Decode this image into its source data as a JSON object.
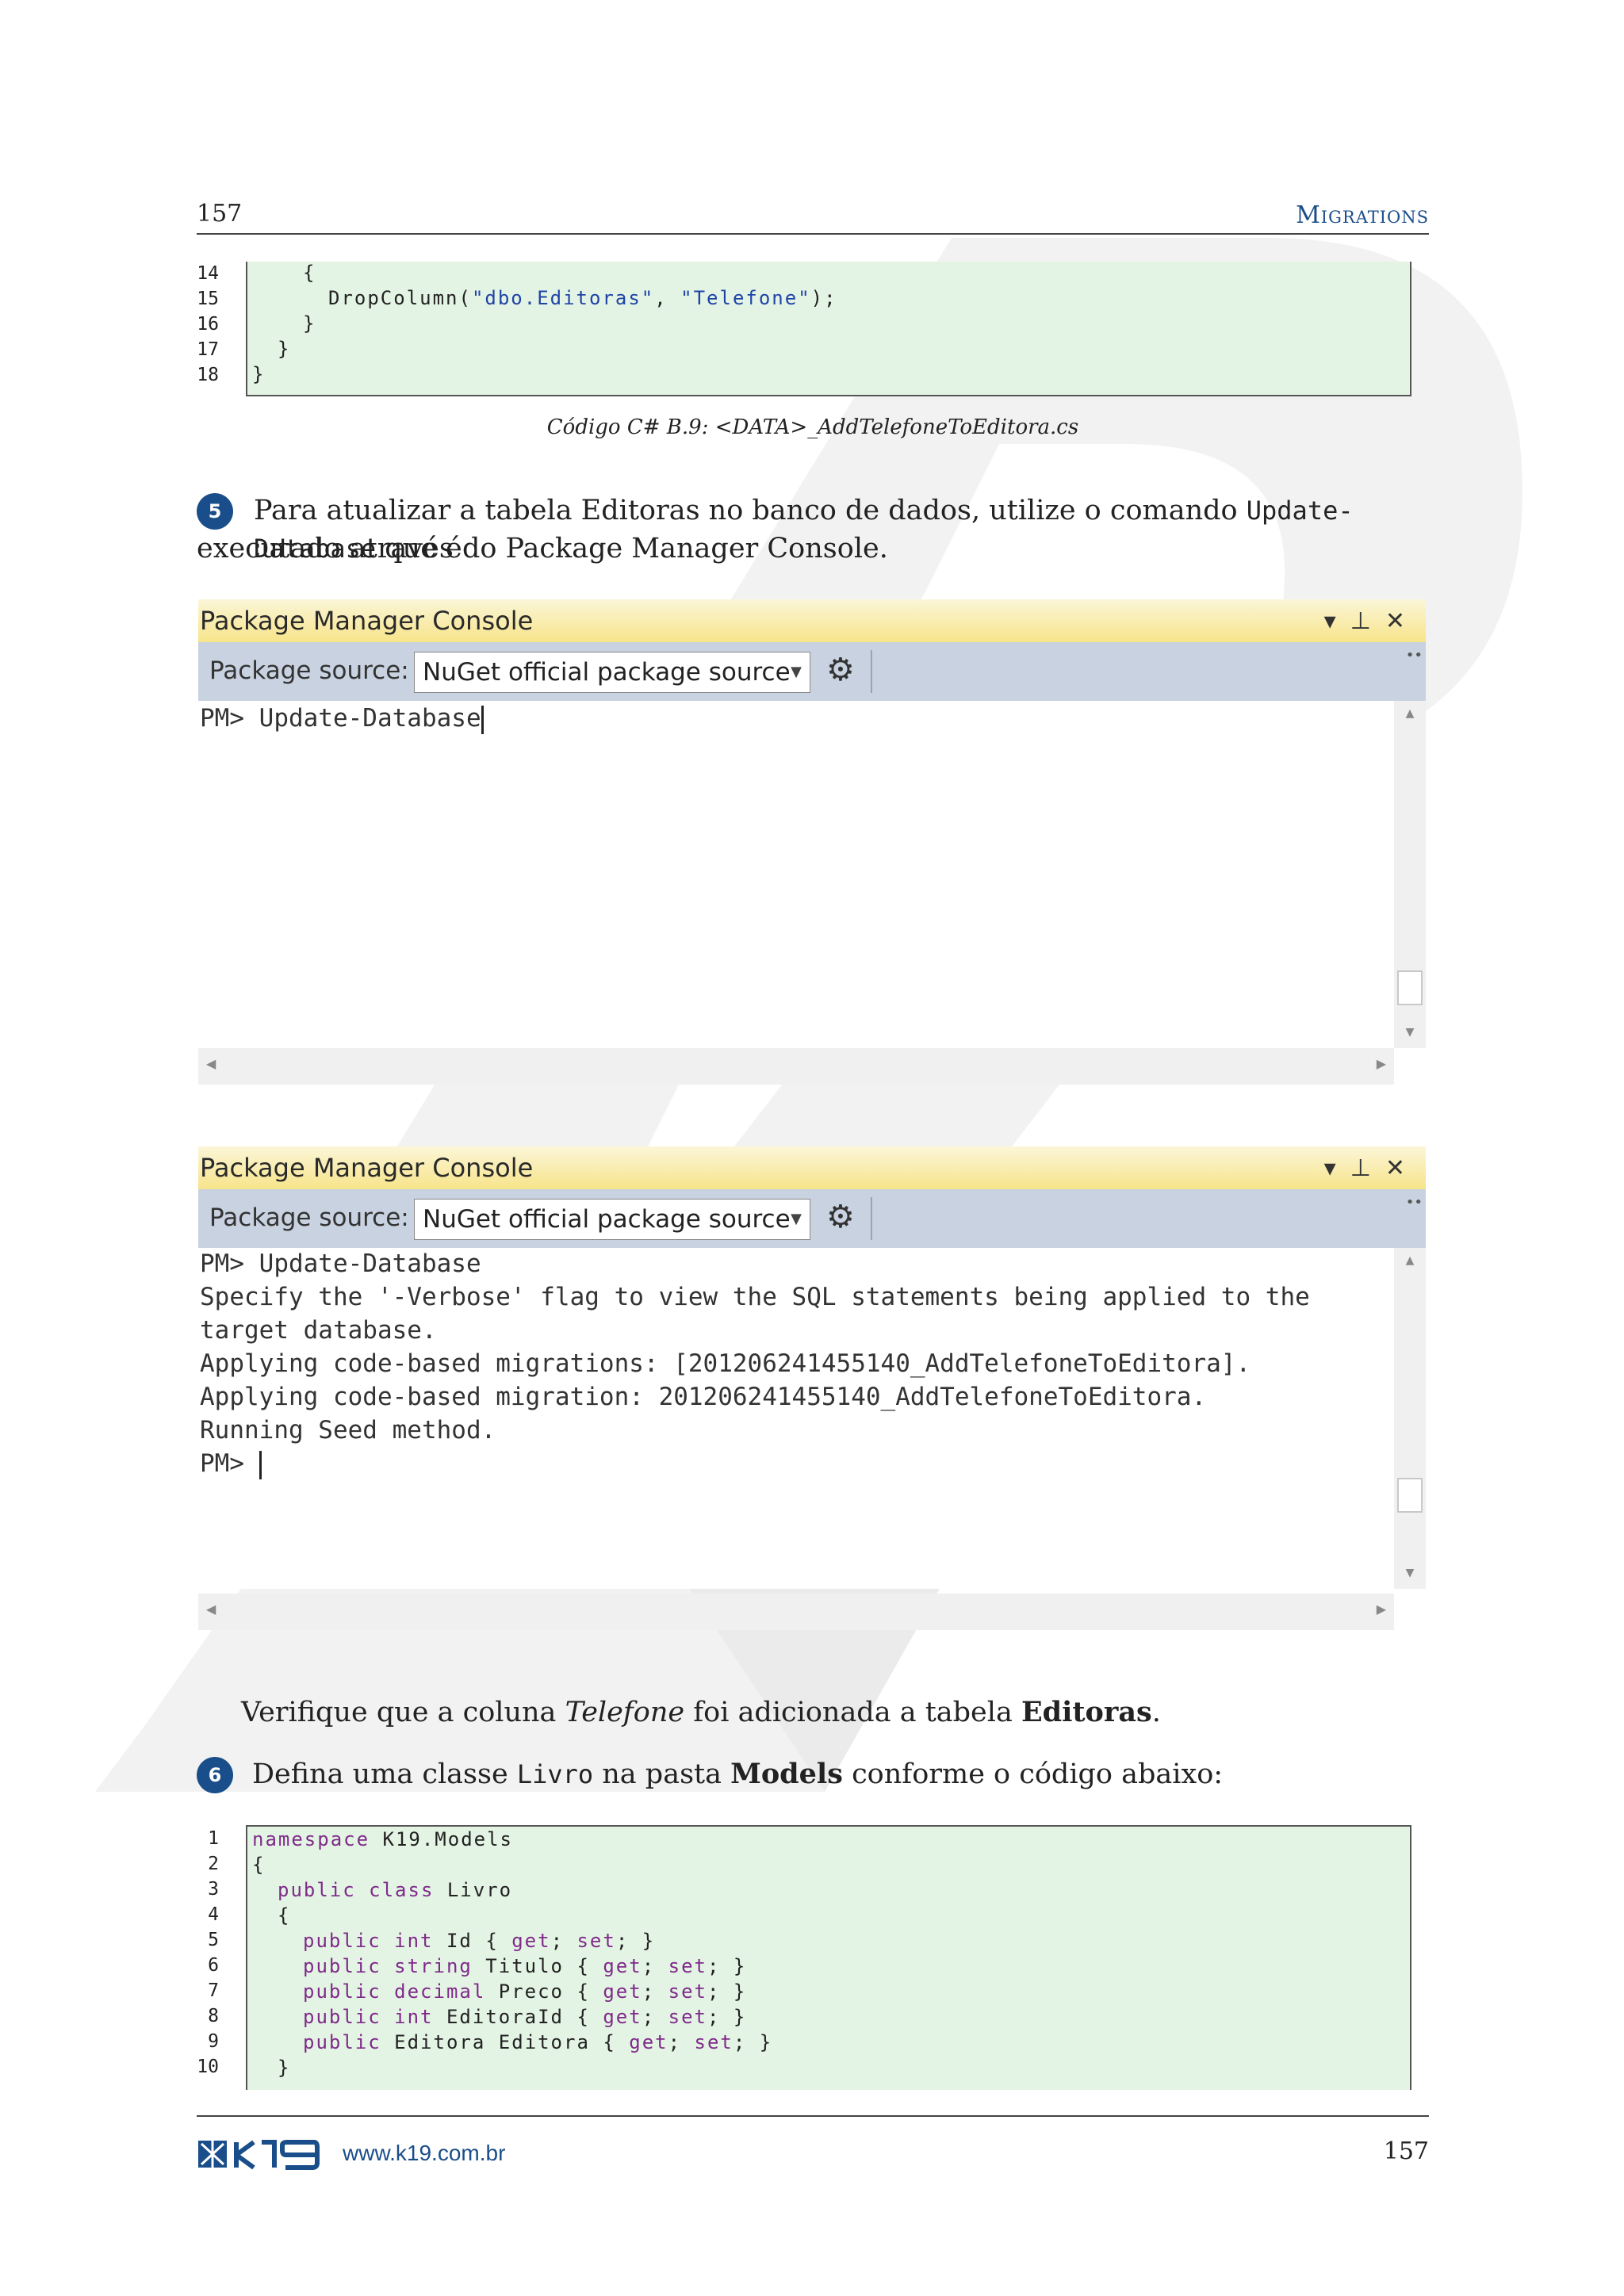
{
  "header": {
    "page_number": "157",
    "section": "Migrations"
  },
  "code_top": {
    "line_numbers": [
      "14",
      "15",
      "16",
      "17",
      "18"
    ],
    "lines": [
      {
        "text": "{"
      },
      {
        "pre": "DropColumn(",
        "s1": "\"dbo.Editoras\"",
        "mid": ", ",
        "s2": "\"Telefone\"",
        "post": ");"
      },
      {
        "text": "}"
      },
      {
        "text": "}"
      },
      {
        "text": "}"
      }
    ]
  },
  "caption": "Código C# B.9: <DATA>_AddTelefoneToEditora.cs",
  "step5": {
    "number": "5",
    "text_before": "Para atualizar a tabela Editoras no banco de dados, utilize o comando ",
    "command": "Update-Database",
    "text_after": " que é",
    "text_line2": "executado através do Package Manager Console."
  },
  "console1": {
    "title": "Package Manager Console",
    "source_label": "Package source:",
    "source_value": "NuGet official package source",
    "lines": [
      "PM> Update-Database"
    ]
  },
  "console2": {
    "title": "Package Manager Console",
    "source_label": "Package source:",
    "source_value": "NuGet official package source",
    "lines": [
      "PM> Update-Database",
      "Specify the '-Verbose' flag to view the SQL statements being applied to the",
      "target database.",
      "Applying code-based migrations: [201206241455140_AddTelefoneToEditora].",
      "Applying code-based migration: 201206241455140_AddTelefoneToEditora.",
      "Running Seed method.",
      "PM> "
    ]
  },
  "verify": {
    "pre": "Verifique que a coluna ",
    "italic": "Telefone",
    "mid": " foi adicionada a tabela ",
    "bold": "Editoras",
    "post": "."
  },
  "step6": {
    "number": "6",
    "pre": "Defina uma classe ",
    "mono": "Livro",
    "mid": " na pasta ",
    "bold": "Models",
    "post": " conforme o código abaixo:"
  },
  "code_bottom": {
    "line_numbers": [
      "1",
      "2",
      "3",
      "4",
      "5",
      "6",
      "7",
      "8",
      "9",
      "10"
    ],
    "l1_kw": "namespace",
    "l1_rest": " K19.Models",
    "l2": "{",
    "l3_kw": "public class",
    "l3_rest": " Livro",
    "l4": "{",
    "p_kw": "public",
    "l5_type": "int",
    "l5_name": " Id { ",
    "l6_type": "string",
    "l6_name": " Titulo { ",
    "l7_type": "decimal",
    "l7_name": " Preco { ",
    "l8_type": "int",
    "l8_name": " EditoraId { ",
    "l9_name": " Editora Editora { ",
    "get_kw": "get",
    "set_kw": "set",
    "close": "; }",
    "l10": "}"
  },
  "footer": {
    "url": "www.k19.com.br",
    "page_number": "157"
  },
  "colors": {
    "code_bg": "#e4f4e4",
    "keyword": "#7f2a8a",
    "string": "#1f44a8",
    "accent": "#1a4e8a"
  }
}
